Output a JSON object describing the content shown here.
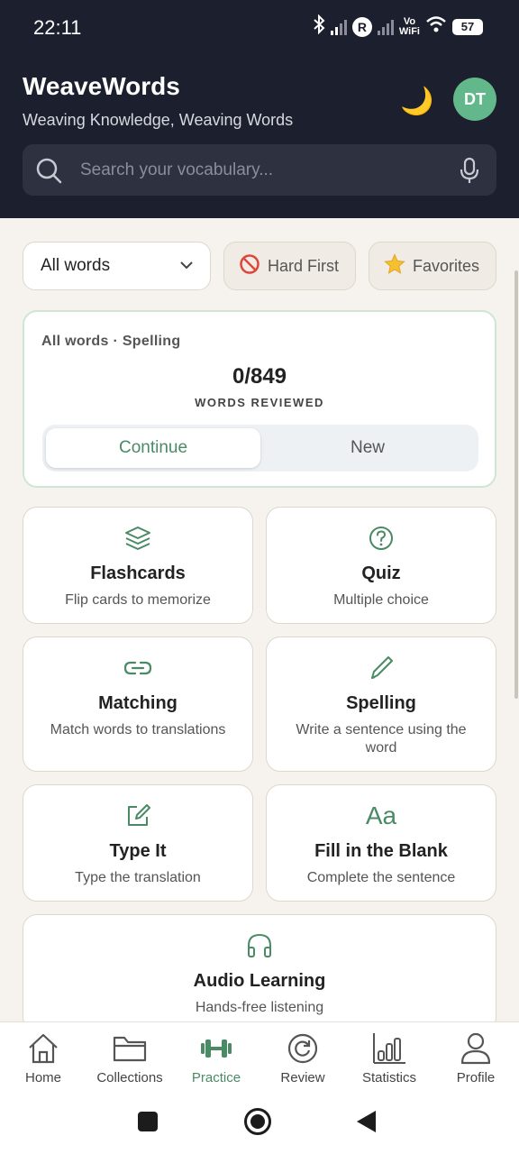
{
  "status_bar": {
    "time": "22:11",
    "vowifi_line1": "Vo",
    "vowifi_line2": "WiFi",
    "battery": "57"
  },
  "header": {
    "title": "WeaveWords",
    "tagline": "Weaving Knowledge, Weaving Words",
    "avatar_initials": "DT"
  },
  "search": {
    "placeholder": "Search your vocabulary..."
  },
  "filters": {
    "word_set": "All words",
    "hard_first": "Hard First",
    "favorites": "Favorites"
  },
  "progress": {
    "label": "All words · Spelling",
    "count": "0/849",
    "sub": "WORDS REVIEWED",
    "continue": "Continue",
    "new": "New"
  },
  "modes": [
    {
      "title": "Flashcards",
      "desc": "Flip cards to memorize",
      "icon": "layers-icon"
    },
    {
      "title": "Quiz",
      "desc": "Multiple choice",
      "icon": "question-circle-icon"
    },
    {
      "title": "Matching",
      "desc": "Match words to translations",
      "icon": "link-icon"
    },
    {
      "title": "Spelling",
      "desc": "Write a sentence using the word",
      "icon": "pencil-icon"
    },
    {
      "title": "Type It",
      "desc": "Type the translation",
      "icon": "edit-square-icon"
    },
    {
      "title": "Fill in the Blank",
      "desc": "Complete the sentence",
      "icon": "text-aa-icon",
      "icon_text": "Aa"
    },
    {
      "title": "Audio Learning",
      "desc": "Hands-free listening",
      "icon": "headphones-icon"
    }
  ],
  "nav": [
    {
      "label": "Home",
      "icon": "home-icon"
    },
    {
      "label": "Collections",
      "icon": "folder-icon"
    },
    {
      "label": "Practice",
      "icon": "dumbbell-icon"
    },
    {
      "label": "Review",
      "icon": "refresh-icon"
    },
    {
      "label": "Statistics",
      "icon": "bar-chart-icon"
    },
    {
      "label": "Profile",
      "icon": "user-icon"
    }
  ],
  "colors": {
    "header_bg": "#1c1f2d",
    "accent": "#4a8a65",
    "avatar": "#62b88b",
    "page_bg": "#f6f3ee"
  }
}
